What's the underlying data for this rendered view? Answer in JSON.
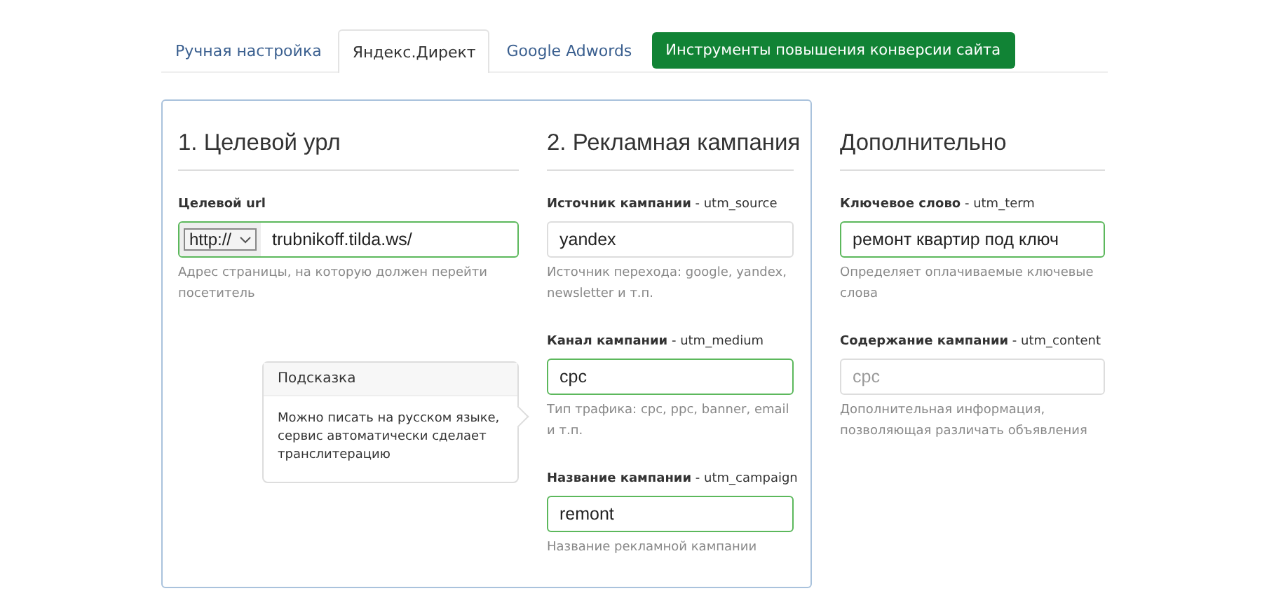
{
  "tabs": [
    {
      "label": "Ручная настройка",
      "kind": "tab",
      "selected": false
    },
    {
      "label": "Яндекс.Директ",
      "kind": "tab",
      "selected": true
    },
    {
      "label": "Google Adwords",
      "kind": "tab",
      "selected": false
    },
    {
      "label": "Инструменты повышения конверсии сайта",
      "kind": "button"
    }
  ],
  "panel": {
    "columns": [
      {
        "heading": "1. Целевой урл",
        "fields": [
          {
            "label": "Целевой url",
            "protocol": "http://",
            "value": "trubnikoff.tilda.ws/",
            "valid": true,
            "help": "Адрес страницы, на которую должен перейти посетитель"
          }
        ]
      },
      {
        "heading": "2. Рекламная кампания",
        "fields": [
          {
            "label": "**Источник кампании** - utm_source",
            "value": "yandex",
            "valid": false,
            "help": "Источник перехода: google, yandex, newsletter и т.п."
          },
          {
            "label": "**Канал кампании** - utm_medium",
            "value": "cpc",
            "valid": true,
            "help": "Тип трафика: cpc, ppc, banner, email и т.п."
          },
          {
            "label": "**Название кампании** - utm_campaign",
            "value": "remont",
            "valid": true,
            "help": "Название рекламной кампании"
          }
        ]
      }
    ],
    "tooltip": {
      "title": "Подсказка",
      "text": "Можно писать на русском языке, сервис автоматически сделает транслитерацию"
    }
  },
  "extra": {
    "heading": "Дополнительно",
    "fields": [
      {
        "label": "**Ключевое слово** - utm_term",
        "value": "ремонт квартир под ключ",
        "valid": true,
        "help": "Определяет оплачиваемые ключевые слова"
      },
      {
        "label": "**Содержание кампании** - utm_content",
        "placeholder": "cpc",
        "valid": false,
        "help": "Дополнительная информация, позволяющая различать объявления"
      }
    ]
  }
}
